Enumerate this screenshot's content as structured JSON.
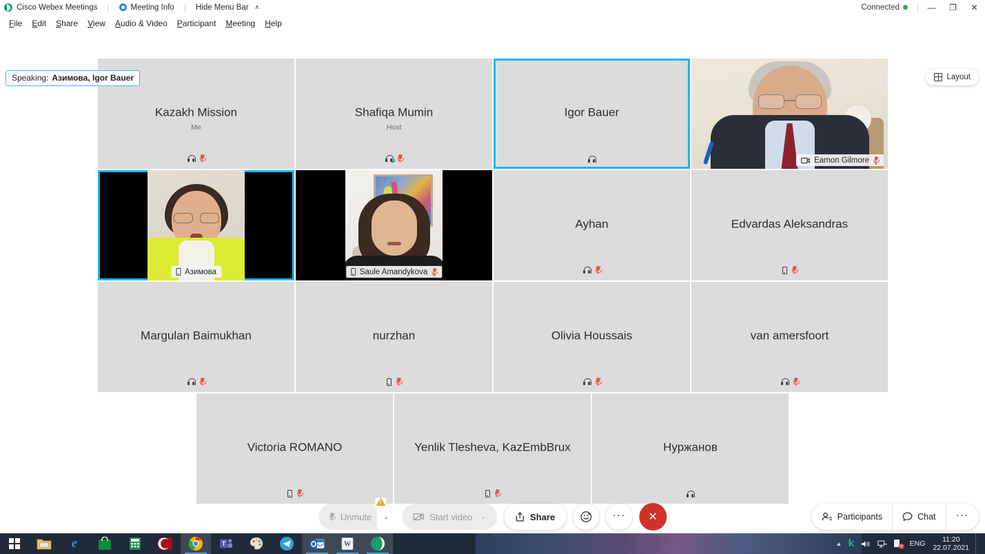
{
  "window": {
    "app_title": "Cisco Webex Meetings",
    "meeting_info": "Meeting Info",
    "hide_menu_bar": "Hide Menu Bar",
    "hide_menu_caret": "∧",
    "connection_status": "Connected",
    "minimize": "—",
    "maximize": "❐",
    "close": "✕"
  },
  "menu": {
    "items": [
      {
        "pre": "",
        "key": "F",
        "post": "ile"
      },
      {
        "pre": "",
        "key": "E",
        "post": "dit"
      },
      {
        "pre": "",
        "key": "S",
        "post": "hare"
      },
      {
        "pre": "",
        "key": "V",
        "post": "iew"
      },
      {
        "pre": "",
        "key": "A",
        "post": "udio & Video"
      },
      {
        "pre": "",
        "key": "P",
        "post": "articipant"
      },
      {
        "pre": "",
        "key": "M",
        "post": "eeting"
      },
      {
        "pre": "",
        "key": "H",
        "post": "elp"
      }
    ]
  },
  "speaking": {
    "label": "Speaking:",
    "names": "Азимова, Igor Bauer"
  },
  "layout_button": {
    "label": "Layout",
    "icon": "grid-icon"
  },
  "grid": {
    "rows": [
      [
        {
          "name": "Kazakh Mission",
          "sub": "Me",
          "type": "avatar",
          "speaking": false,
          "icons": [
            "headset-icon",
            "mic-muted-icon"
          ]
        },
        {
          "name": "Shafiqa Mumin",
          "sub": "Host",
          "type": "avatar",
          "speaking": false,
          "icons": [
            "headset-presence-icon",
            "mic-muted-icon"
          ]
        },
        {
          "name": "Igor Bauer",
          "sub": "",
          "type": "avatar",
          "speaking": true,
          "icons": [
            "headset-icon"
          ]
        },
        {
          "name": "Eamon Gilmore",
          "sub": "",
          "type": "video",
          "scene": "gilmore",
          "speaking": false,
          "badge_icons": [
            "video-icon",
            "mic-muted-icon"
          ]
        }
      ],
      [
        {
          "name": "Азимова",
          "sub": "",
          "type": "video",
          "scene": "azimova",
          "speaking": true,
          "badge_icons": [
            "phone-icon"
          ]
        },
        {
          "name": "Saule Amandykova",
          "sub": "",
          "type": "video",
          "scene": "saule",
          "speaking": false,
          "badge_icons": [
            "phone-icon",
            "mic-muted-icon"
          ]
        },
        {
          "name": "Ayhan",
          "sub": "",
          "type": "avatar",
          "speaking": false,
          "icons": [
            "headset-icon",
            "mic-muted-icon"
          ]
        },
        {
          "name": "Edvardas Aleksandras",
          "sub": "",
          "type": "avatar",
          "speaking": false,
          "icons": [
            "phone-icon",
            "mic-muted-icon"
          ]
        }
      ],
      [
        {
          "name": "Margulan Baimukhan",
          "sub": "",
          "type": "avatar",
          "speaking": false,
          "icons": [
            "headset-icon",
            "mic-muted-icon"
          ]
        },
        {
          "name": "nurzhan",
          "sub": "",
          "type": "avatar",
          "speaking": false,
          "icons": [
            "phone-icon",
            "mic-muted-icon"
          ]
        },
        {
          "name": "Olivia Houssais",
          "sub": "",
          "type": "avatar",
          "speaking": false,
          "icons": [
            "headset-icon",
            "mic-muted-icon"
          ]
        },
        {
          "name": "van amersfoort",
          "sub": "",
          "type": "avatar",
          "speaking": false,
          "icons": [
            "headset-icon",
            "mic-muted-icon"
          ]
        }
      ],
      [
        {
          "name": "Victoria ROMANO",
          "sub": "",
          "type": "avatar",
          "speaking": false,
          "icons": [
            "phone-icon",
            "mic-muted-icon"
          ]
        },
        {
          "name": "Yenlik Tlesheva, KazEmbBrux",
          "sub": "",
          "type": "avatar",
          "speaking": false,
          "icons": [
            "phone-icon",
            "mic-muted-icon"
          ]
        },
        {
          "name": "Нуржанов",
          "sub": "",
          "type": "avatar",
          "speaking": false,
          "icons": [
            "headset-icon"
          ]
        }
      ]
    ]
  },
  "controls": {
    "unmute": "Unmute",
    "unmute_caret": "⌄",
    "start_video": "Start video",
    "start_video_caret": "⌄",
    "share": "Share",
    "reactions_icon": "smiley-icon",
    "more_icon": "ellipsis-icon",
    "more_label": "···",
    "leave_label": "✕",
    "participants": "Participants",
    "chat": "Chat",
    "right_more_label": "···"
  },
  "taskbar": {
    "apps": [
      {
        "name": "file-explorer",
        "glyph": "🗀",
        "label": "",
        "bg": "#e8b84b",
        "color": "#6a4a10",
        "active": false
      },
      {
        "name": "internet-explorer",
        "glyph": "e",
        "label": "",
        "bg": "transparent",
        "color": "#1d9bd7",
        "active": false
      },
      {
        "name": "microsoft-store",
        "glyph": "🛍",
        "label": "",
        "bg": "#128a3a",
        "color": "#ffffff",
        "active": false
      },
      {
        "name": "calculator",
        "glyph": "▦",
        "label": "",
        "bg": "#1f8c4a",
        "color": "#ffffff",
        "active": false
      },
      {
        "name": "red-c-app",
        "glyph": "C",
        "label": "",
        "bg": "#a8101a",
        "color": "#ffffff",
        "active": false
      },
      {
        "name": "google-chrome",
        "glyph": "",
        "label": "",
        "bg": "transparent",
        "color": "#ffffff",
        "active": true
      },
      {
        "name": "microsoft-teams",
        "glyph": "T",
        "label": "",
        "bg": "#5058a8",
        "color": "#ffffff",
        "active": false
      },
      {
        "name": "paint",
        "glyph": "🎨",
        "label": "",
        "bg": "#d9534f",
        "color": "#ffffff",
        "active": false
      },
      {
        "name": "telegram",
        "glyph": "➤",
        "label": "",
        "bg": "#2f9fd8",
        "color": "#ffffff",
        "active": false
      },
      {
        "name": "outlook",
        "glyph": "O",
        "label": "",
        "bg": "#0f64b4",
        "color": "#ffffff",
        "active": true
      },
      {
        "name": "microsoft-word",
        "glyph": "W",
        "label": "",
        "bg": "#f2f2f2",
        "color": "#2b5797",
        "active": true
      },
      {
        "name": "webex",
        "glyph": "",
        "label": "",
        "bg": "transparent",
        "color": "#ffffff",
        "active": true
      }
    ],
    "tray": {
      "overflow_arrow": "▲",
      "kaspersky": "k",
      "volume_icon": "volume-icon",
      "network_icon": "network-icon",
      "action_center_icon": "action-center-icon",
      "language": "ENG",
      "time": "11:20",
      "date": "22.07.2021"
    }
  },
  "colors": {
    "accent": "#19b5ee",
    "tile_bg": "#dcdcdc",
    "muted_red": "#e8544a",
    "leave_red": "#d0322b",
    "taskbar": "#1f2a3a"
  }
}
